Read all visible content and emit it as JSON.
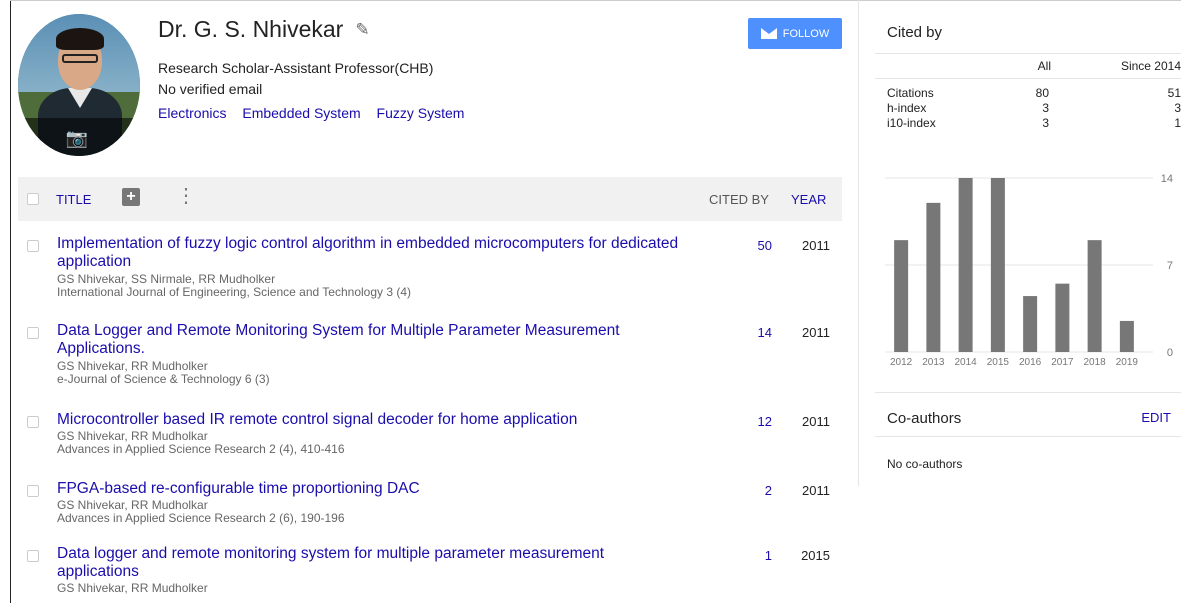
{
  "profile": {
    "name": "Dr. G. S. Nhivekar",
    "affiliation": "Research Scholar-Assistant Professor(CHB)",
    "email": "No verified email",
    "interests": [
      "Electronics",
      "Embedded System",
      "Fuzzy System"
    ],
    "follow_label": "FOLLOW",
    "edit_icon": "pencil-icon",
    "camera_icon": "camera-icon"
  },
  "table": {
    "title_label": "TITLE",
    "cited_by_label": "CITED BY",
    "year_label": "YEAR",
    "rows": [
      {
        "title": "Implementation of fuzzy logic control algorithm in embedded microcomputers for dedicated application",
        "authors": "GS Nhivekar, SS Nirmale, RR Mudholker",
        "venue": "International Journal of Engineering, Science and Technology 3 (4)",
        "cited_by": "50",
        "year": "2011"
      },
      {
        "title": "Data Logger and Remote Monitoring System for Multiple Parameter Measurement Applications.",
        "authors": "GS Nhivekar, RR Mudholker",
        "venue": "e-Journal of Science & Technology 6 (3)",
        "cited_by": "14",
        "year": "2011"
      },
      {
        "title": "Microcontroller based IR remote control signal decoder for home application",
        "authors": "GS Nhivekar, RR Mudholkar",
        "venue": "Advances in Applied Science Research 2 (4), 410-416",
        "cited_by": "12",
        "year": "2011"
      },
      {
        "title": "FPGA-based re-configurable time proportioning DAC",
        "authors": "GS Nhivekar, RR Mudholkar",
        "venue": "Advances in Applied Science Research 2 (6), 190-196",
        "cited_by": "2",
        "year": "2011"
      },
      {
        "title": "Data logger and remote monitoring system for multiple parameter measurement applications",
        "authors": "GS Nhivekar, RR Mudholker",
        "venue": "",
        "cited_by": "1",
        "year": "2015"
      }
    ]
  },
  "cited_by": {
    "title": "Cited by",
    "col_all": "All",
    "col_since": "Since 2014",
    "stats": [
      {
        "name": "Citations",
        "all": "80",
        "since": "51"
      },
      {
        "name": "h-index",
        "all": "3",
        "since": "3"
      },
      {
        "name": "i10-index",
        "all": "3",
        "since": "1"
      }
    ]
  },
  "coauthors": {
    "title": "Co-authors",
    "edit_label": "EDIT",
    "empty_text": "No co-authors"
  },
  "chart_data": {
    "type": "bar",
    "categories": [
      "2012",
      "2013",
      "2014",
      "2015",
      "2016",
      "2017",
      "2018",
      "2019"
    ],
    "values": [
      9,
      12,
      14,
      14,
      4.5,
      5.5,
      9,
      2.5
    ],
    "y_ticks": [
      "0",
      "7",
      "14"
    ],
    "ylim": [
      0,
      14
    ],
    "bar_color": "#777777",
    "grid": true,
    "y_axis_side": "right"
  },
  "colors": {
    "link": "#1a0dab",
    "follow": "#4d90fe"
  }
}
